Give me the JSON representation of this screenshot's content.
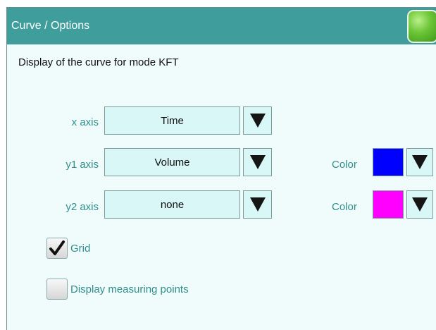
{
  "window": {
    "title": "Curve / Options"
  },
  "heading": "Display of the curve for mode KFT",
  "rows": [
    {
      "label": "x axis",
      "value": "Time"
    },
    {
      "label": "y1 axis",
      "value": "Volume",
      "color_label": "Color",
      "color": "#0000ff"
    },
    {
      "label": "y2 axis",
      "value": "none",
      "color_label": "Color",
      "color": "#ff00ff"
    }
  ],
  "grid": {
    "label": "Grid",
    "checked": true
  },
  "measuring_points": {
    "label": "Display measuring points",
    "checked": false
  },
  "colors": {
    "titlebar": "#3f9e9b",
    "label_text": "#2e8f8c",
    "field_bg": "#d8f7f6",
    "status_light": "#6cc436"
  },
  "icons": {
    "dropdown": "triangle-down-icon",
    "check": "checkmark-icon"
  }
}
